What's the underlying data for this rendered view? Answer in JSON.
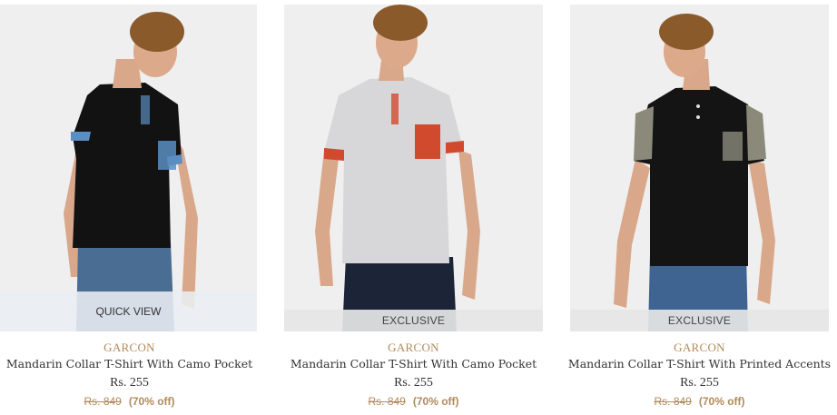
{
  "products": [
    {
      "overlay": "QUICK VIEW",
      "brand": "GARCON",
      "title": "Mandarin Collar T-Shirt With Camo Pocket",
      "price": "Rs. 255",
      "mrp": "Rs. 849",
      "discount": "(70% off)",
      "shirt_color": "#121212",
      "accent_color": "#5b8ec2"
    },
    {
      "badge": "EXCLUSIVE",
      "brand": "GARCON",
      "title": "Mandarin Collar T-Shirt With Camo Pocket",
      "price": "Rs. 255",
      "mrp": "Rs. 849",
      "discount": "(70% off)",
      "shirt_color": "#d7d7d9",
      "accent_color": "#d24a2e"
    },
    {
      "badge": "EXCLUSIVE",
      "brand": "GARCON",
      "title": "Mandarin Collar T-Shirt With Printed Accents",
      "price": "Rs. 255",
      "mrp": "Rs. 849",
      "discount": "(70% off)",
      "shirt_color": "#141414",
      "accent_color": "#8b8a7a"
    }
  ],
  "colors": {
    "brand_text": "#b08b5b",
    "image_bg": "#efefef"
  }
}
